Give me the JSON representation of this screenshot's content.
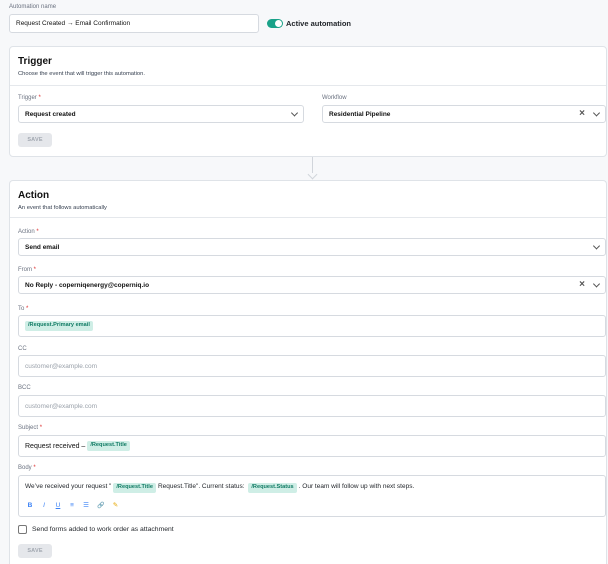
{
  "automation": {
    "name_label": "Automation name",
    "name_value": "Request Created → Email Confirmation",
    "active_label": "Active automation"
  },
  "trigger": {
    "title": "Trigger",
    "subtitle": "Choose the event that will trigger this automation.",
    "trigger_label": "Trigger",
    "trigger_value": "Request created",
    "workflow_label": "Workflow",
    "workflow_value": "Residential Pipeline",
    "save_label": "SAVE"
  },
  "action": {
    "title": "Action",
    "subtitle": "An event that follows automatically",
    "action_label": "Action",
    "action_value": "Send email",
    "from_label": "From",
    "from_value": "No Reply - coperniqenergy@coperniq.io",
    "to_label": "To",
    "to_chip": "/Request.Primary email",
    "cc_label": "CC",
    "cc_placeholder": "customer@example.com",
    "bcc_label": "BCC",
    "bcc_placeholder": "customer@example.com",
    "subject_label": "Subject",
    "subject_prefix": "Request received –",
    "subject_chip": "/Request.Title",
    "body_label": "Body",
    "body_part1": "We’ve received your request \"",
    "body_chip1": "/Request.Title",
    "body_part2": "Request.Title\". Current status:",
    "body_chip2": "/Request.Status",
    "body_part3": ". Our team will follow up with next steps.",
    "toolbar": [
      "B",
      "I",
      "U",
      "≡",
      "☰",
      "🔗",
      "✎"
    ],
    "checkbox_label": "Send forms added to work order as attachment",
    "save_label": "SAVE"
  },
  "required_mark": "*",
  "colors": {
    "accent": "#1aa289",
    "chip_bg": "#cfeee6",
    "chip_text": "#0f7a63"
  }
}
